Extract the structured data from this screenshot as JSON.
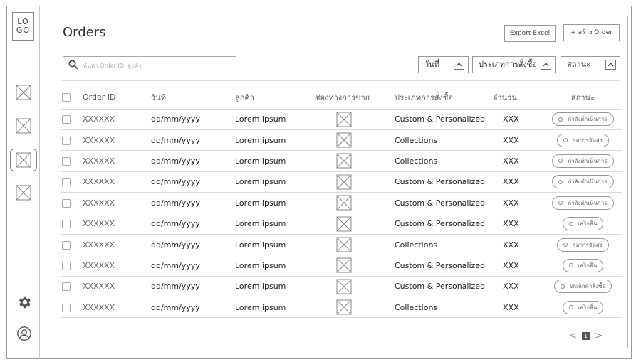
{
  "logo": {
    "line1": "LO",
    "line2": "GO"
  },
  "sidebar": {
    "items": [
      {
        "icon": "image-placeholder-icon",
        "active": false
      },
      {
        "icon": "image-placeholder-icon",
        "active": false
      },
      {
        "icon": "image-placeholder-icon",
        "active": true
      },
      {
        "icon": "image-placeholder-icon",
        "active": false
      }
    ],
    "bottom": [
      {
        "icon": "gear-icon"
      },
      {
        "icon": "user-icon"
      }
    ]
  },
  "header": {
    "title": "Orders",
    "export_label": "Export Excel",
    "create_label": "+ สร้าง Order"
  },
  "search": {
    "placeholder": "ค้นหา Order ID, ลูกค้า"
  },
  "filters": [
    {
      "label": "วันที่"
    },
    {
      "label": "ประเภทการสั่งซื้อ"
    },
    {
      "label": "สถานะ"
    }
  ],
  "table": {
    "columns": [
      "Order ID",
      "วันที่",
      "ลูกค้า",
      "ช่องทางการขาย",
      "ประเภทการสั่งซื้อ",
      "จำนวน",
      "สถานะ"
    ],
    "rows": [
      {
        "order_id": "XXXXXX",
        "date": "dd/mm/yyyy",
        "customer": "Lorem ipsum",
        "type": "Custom & Personalized",
        "qty": "XXX",
        "status": "กำลังดำเนินการ"
      },
      {
        "order_id": "XXXXXX",
        "date": "dd/mm/yyyy",
        "customer": "Lorem ipsum",
        "type": "Collections",
        "qty": "XXX",
        "status": "รอการจัดส่ง"
      },
      {
        "order_id": "XXXXXX",
        "date": "dd/mm/yyyy",
        "customer": "Lorem ipsum",
        "type": "Collections",
        "qty": "XXX",
        "status": "กำลังดำเนินการ"
      },
      {
        "order_id": "XXXXXX",
        "date": "dd/mm/yyyy",
        "customer": "Lorem ipsum",
        "type": "Custom & Personalized",
        "qty": "XXX",
        "status": "กำลังดำเนินการ"
      },
      {
        "order_id": "XXXXXX",
        "date": "dd/mm/yyyy",
        "customer": "Lorem ipsum",
        "type": "Custom & Personalized",
        "qty": "XXX",
        "status": "กำลังดำเนินการ"
      },
      {
        "order_id": "XXXXXX",
        "date": "dd/mm/yyyy",
        "customer": "Lorem ipsum",
        "type": "Custom & Personalized",
        "qty": "XXX",
        "status": "เสร็จสิ้น"
      },
      {
        "order_id": "XXXXXX",
        "date": "dd/mm/yyyy",
        "customer": "Lorem ipsum",
        "type": "Collections",
        "qty": "XXX",
        "status": "รอการจัดส่ง"
      },
      {
        "order_id": "XXXXXX",
        "date": "dd/mm/yyyy",
        "customer": "Lorem ipsum",
        "type": "Custom & Personalized",
        "qty": "XXX",
        "status": "เสร็จสิ้น"
      },
      {
        "order_id": "XXXXXX",
        "date": "dd/mm/yyyy",
        "customer": "Lorem ipsum",
        "type": "Custom & Personalized",
        "qty": "XXX",
        "status": "ยกเลิกคำสั่งซื้อ"
      },
      {
        "order_id": "XXXXXX",
        "date": "dd/mm/yyyy",
        "customer": "Lorem ipsum",
        "type": "Collections",
        "qty": "XXX",
        "status": "เสร็จสิ้น"
      }
    ]
  },
  "pagination": {
    "current": "1",
    "prev": "<",
    "next": ">"
  }
}
